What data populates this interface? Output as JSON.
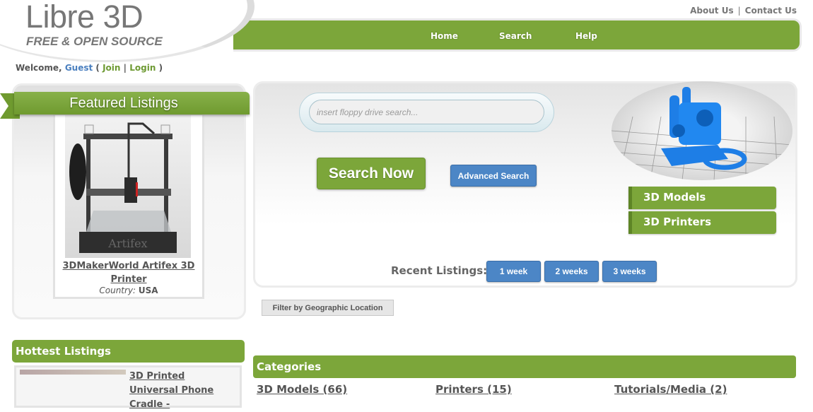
{
  "header": {
    "logo_title": "Libre 3D",
    "logo_subtitle": "FREE & OPEN SOURCE",
    "top_links": [
      "About Us",
      "Contact Us"
    ],
    "top_links_separator": "|",
    "nav": [
      "Home",
      "Search",
      "Help"
    ]
  },
  "welcome": {
    "prefix": "Welcome,",
    "user": "Guest",
    "open_paren": "(",
    "join": "Join",
    "pipe": "|",
    "login": "Login",
    "close_paren": ")"
  },
  "featured": {
    "title": "Featured Listings",
    "listing_title": "3DMakerWorld Artifex 3D Printer",
    "country_label": "Country:",
    "country_value": "USA",
    "image_text": "Artifex"
  },
  "search": {
    "placeholder": "insert floppy drive search...",
    "value": "",
    "search_now": "Search Now",
    "advanced": "Advanced Search",
    "side_buttons": [
      "3D Models",
      "3D Printers"
    ],
    "recent_label": "Recent Listings:",
    "recent_buttons": [
      "1 week",
      "2 weeks",
      "3 weeks"
    ],
    "geo_filter": "Filter by Geographic Location"
  },
  "hottest": {
    "title": "Hottest Listings",
    "items": [
      {
        "title": "3D Printed Universal Phone Cradle -"
      }
    ]
  },
  "categories": {
    "title": "Categories",
    "items": [
      {
        "label": "3D Models (66)"
      },
      {
        "label": "Printers (15)"
      },
      {
        "label": "Tutorials/Media (2)"
      }
    ]
  },
  "colors": {
    "brand_green": "#7ca63a",
    "button_blue": "#4c86c6",
    "link_blue": "#4a7fbf",
    "text_gray": "#555555"
  }
}
